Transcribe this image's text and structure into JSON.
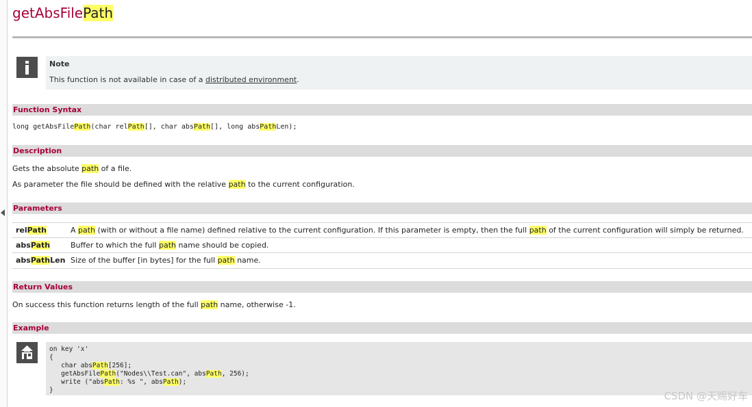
{
  "title": {
    "base": "getAbsFile",
    "highlight": "Path"
  },
  "note": {
    "title": "Note",
    "text_before": "This function is not available in case of a ",
    "link": "distributed environment",
    "text_after": "."
  },
  "sections": {
    "syntax": "Function Syntax",
    "description": "Description",
    "parameters": "Parameters",
    "return_values": "Return Values",
    "example": "Example"
  },
  "syntax": {
    "p1": "long getAbsFile",
    "h1": "Path",
    "p2": "(char rel",
    "h2": "Path",
    "p3": "[], char abs",
    "h3": "Path",
    "p4": "[], long abs",
    "h4": "Path",
    "p5": "Len);"
  },
  "description": {
    "line1": {
      "before": "Gets the absolute ",
      "hl": "path",
      "after": " of a file."
    },
    "line2": {
      "before": "As parameter the file should be defined with the relative ",
      "hl": "path",
      "after": " to the current configuration."
    }
  },
  "parameters": [
    {
      "name_pre": "rel",
      "name_hl": "Path",
      "name_post": "",
      "d1": "A ",
      "dh1": "path",
      "d2": " (with or without a file name) defined relative to the current configuration. If this parameter is empty, then the full ",
      "dh2": "path",
      "d3": " of the current configuration will simply be returned."
    },
    {
      "name_pre": "abs",
      "name_hl": "Path",
      "name_post": "",
      "d1": "Buffer to which the full ",
      "dh1": "path",
      "d2": " name should be copied."
    },
    {
      "name_pre": "abs",
      "name_hl": "Path",
      "name_post": "Len",
      "d1": "Size of the buffer [in bytes] for the full ",
      "dh1": "path",
      "d2": " name."
    }
  ],
  "return_values": {
    "before": "On success this function returns length of the full ",
    "hl": "path",
    "after": " name, otherwise -1."
  },
  "example": {
    "l1": "on key 'x'",
    "l2": "{",
    "l3a": "   char abs",
    "l3h": "Path",
    "l3b": "[256];",
    "l4a": "   getAbsFile",
    "l4h": "Path",
    "l4b": "(\"Nodes\\\\Test.can\", abs",
    "l4h2": "Path",
    "l4c": ", 256);",
    "l5a": "   write (\"abs",
    "l5h": "Path",
    "l5b": ": %s \", abs",
    "l5h2": "Path",
    "l5c": ");",
    "l6": "}"
  },
  "watermark": "CSDN @天赐好车",
  "icons": {
    "note": "info-icon",
    "example": "example-icon"
  },
  "colors": {
    "heading": "#a6003a",
    "highlight": "#ffff66",
    "section_bar": "#dcdcdc"
  }
}
